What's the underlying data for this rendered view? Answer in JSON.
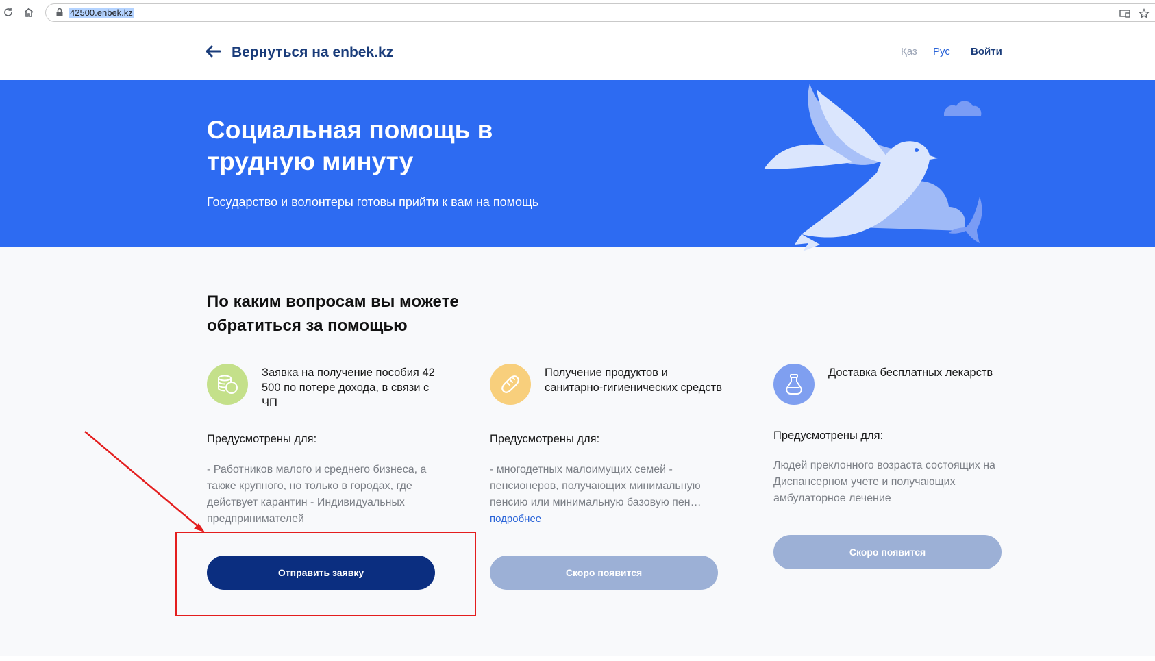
{
  "browser": {
    "url": "42500.enbek.kz",
    "icons": [
      "reload-icon",
      "home-icon",
      "lock-icon",
      "cast-icon",
      "bookmark-star-icon"
    ]
  },
  "header": {
    "back_label": "Вернуться на enbek.kz",
    "lang_kaz": "Қаз",
    "lang_rus": "Рус",
    "login": "Войти"
  },
  "hero": {
    "title": "Социальная помощь в трудную минуту",
    "subtitle": "Государство и волонтеры готовы прийти к вам на помощь",
    "background": "#2d6bf2"
  },
  "section": {
    "title": "По каким вопросам вы можете обратиться за помощью"
  },
  "cards": [
    {
      "icon": "coins-icon",
      "icon_color": "#c4e08a",
      "title": "Заявка на получение пособия 42 500 по потере дохода, в связи с ЧП",
      "for_label": "Предусмотрены для:",
      "desc": "- Работников малого и среднего бизнеса, а также крупного, но только в городах, где действует карантин - Индивидуальных предпринимателей",
      "more": "",
      "button": "Отправить заявку",
      "button_state": "active"
    },
    {
      "icon": "bread-icon",
      "icon_color": "#f8cf7c",
      "title": "Получение продуктов и санитарно-гигиенических средств",
      "for_label": "Предусмотрены для:",
      "desc": "- многодетных малоимущих семей - пенсионеров, получающих минимальную пенсию или минимальную базовую пен…",
      "more": "подробнее",
      "button": "Скоро появится",
      "button_state": "disabled"
    },
    {
      "icon": "medicine-flask-icon",
      "icon_color": "#7f9ff0",
      "title": "Доставка бесплатных лекарств",
      "for_label": "Предусмотрены для:",
      "desc": "Людей преклонного возраста состоящих на Диспансерном учете и получающих амбулаторное лечение",
      "more": "",
      "button": "Скоро появится",
      "button_state": "disabled"
    }
  ],
  "colors": {
    "primary_button": "#0b2e80",
    "disabled_button": "#9cb0d6",
    "annotation": "#e41e1e"
  }
}
